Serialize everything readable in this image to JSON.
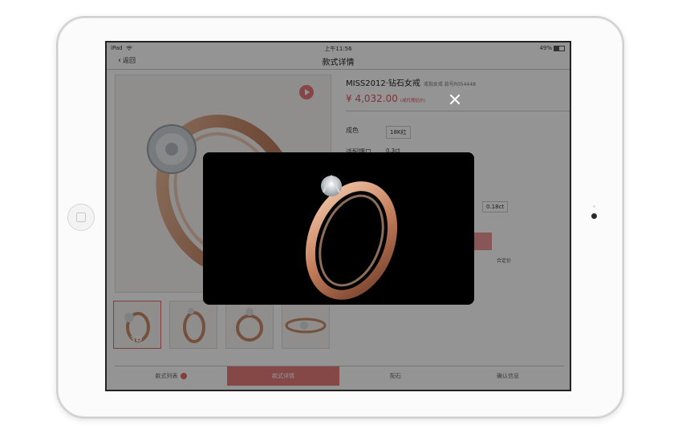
{
  "status": {
    "device": "iPad",
    "time": "上午11:56",
    "battery": "49%",
    "battery_level": 0.49
  },
  "nav": {
    "back": "返回",
    "title": "款式详情"
  },
  "product": {
    "name": "MISS2012·钻石女戒",
    "subtitle": "戒指女戒 款号R054448",
    "price": "¥ 4,032.00",
    "price_note": "(戒托预估价)"
  },
  "attributes": [
    {
      "label": "成色",
      "value": "18K红"
    },
    {
      "label": "适配镶口",
      "value": "0.3ct"
    }
  ],
  "stone_option": "0.18ct",
  "partial_text": "合定价",
  "thumbnails": [
    {
      "tag": "3D",
      "active": true
    },
    {
      "tag": "",
      "active": false
    },
    {
      "tag": "",
      "active": false
    },
    {
      "tag": "",
      "active": false
    }
  ],
  "tabs": [
    {
      "label": "款式列表",
      "active": false,
      "badge": true
    },
    {
      "label": "款式详情",
      "active": true
    },
    {
      "label": "配石",
      "active": false
    },
    {
      "label": "确认信息",
      "active": false
    }
  ],
  "colors": {
    "accent": "#e06a6a",
    "price": "#e0555a",
    "rose_gold": "#d39a7e"
  },
  "icons": [
    "wifi-icon",
    "battery-icon",
    "back-chevron-icon",
    "play-icon",
    "close-icon"
  ]
}
